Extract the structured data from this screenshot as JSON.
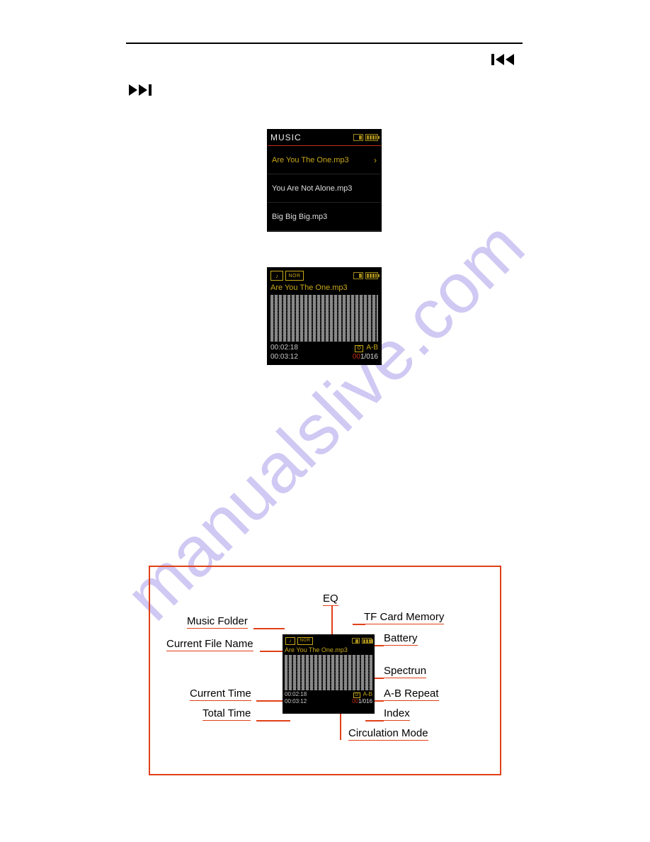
{
  "watermark": "manualslive.com",
  "screen1": {
    "title": "MUSIC",
    "items": [
      {
        "name": "Are You The One.mp3",
        "selected": true
      },
      {
        "name": "You Are Not Alone.mp3",
        "selected": false
      },
      {
        "name": "Big Big Big.mp3",
        "selected": false
      }
    ]
  },
  "screen2": {
    "eq_badge": "NOR",
    "file": "Are You The One.mp3",
    "current_time": "00:02:18",
    "total_time": "00:03:12",
    "circulation": "O",
    "ab": "A-B",
    "index_hl": "00",
    "index_rest": "1/016"
  },
  "diagram": {
    "labels": {
      "eq": "EQ",
      "music_folder": "Music Folder",
      "tf_card": "TF Card Memory",
      "current_file": "Current File Name",
      "battery": "Battery",
      "spectrum": "Spectrun",
      "current_time": "Current Time",
      "ab_repeat": "A-B Repeat",
      "total_time": "Total Time",
      "index": "Index",
      "circulation": "Circulation Mode"
    },
    "mini": {
      "eq_badge": "NOR",
      "file": "Are You The One.mp3",
      "current_time": "00:02:18",
      "total_time": "00:03:12",
      "ab": "A-B",
      "index_hl": "00",
      "index_rest": "1/016",
      "circulation": "O"
    }
  }
}
